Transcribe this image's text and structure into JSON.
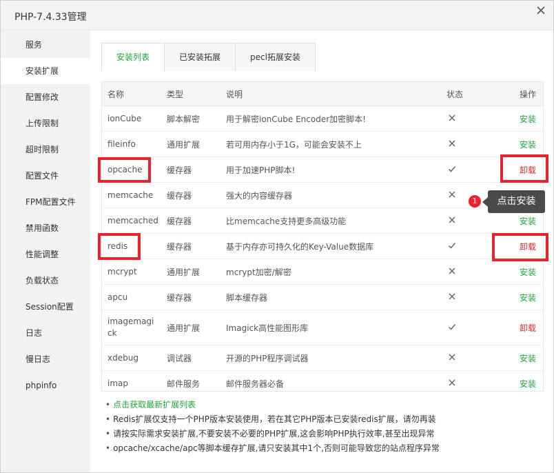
{
  "window": {
    "title": "PHP-7.4.33管理"
  },
  "sidebar": {
    "items": [
      {
        "label": "服务"
      },
      {
        "label": "安装扩展"
      },
      {
        "label": "配置修改"
      },
      {
        "label": "上传限制"
      },
      {
        "label": "超时限制"
      },
      {
        "label": "配置文件"
      },
      {
        "label": "FPM配置文件"
      },
      {
        "label": "禁用函数"
      },
      {
        "label": "性能调整"
      },
      {
        "label": "负载状态"
      },
      {
        "label": "Session配置"
      },
      {
        "label": "日志"
      },
      {
        "label": "慢日志"
      },
      {
        "label": "phpinfo"
      }
    ],
    "active_index": 1
  },
  "tabs": [
    {
      "label": "安装列表"
    },
    {
      "label": "已安装拓展"
    },
    {
      "label": "pecl拓展安装"
    }
  ],
  "table": {
    "headers": {
      "name": "名称",
      "type": "类型",
      "desc": "说明",
      "status": "状态",
      "op": "操作"
    },
    "rows": [
      {
        "name": "ionCube",
        "type": "脚本解密",
        "desc": "用于解密ionCube Encoder加密脚本!",
        "installed": false,
        "op": "安装"
      },
      {
        "name": "fileinfo",
        "type": "通用扩展",
        "desc": "若可用内存小于1G，可能会安装不上",
        "installed": false,
        "op": "安装"
      },
      {
        "name": "opcache",
        "type": "缓存器",
        "desc": "用于加速PHP脚本!",
        "installed": true,
        "op": "卸载"
      },
      {
        "name": "memcache",
        "type": "缓存器",
        "desc": "强大的内容缓存器",
        "installed": false,
        "op": "安装"
      },
      {
        "name": "memcached",
        "type": "缓存器",
        "desc": "比memcache支持更多高级功能",
        "installed": false,
        "op": "安装"
      },
      {
        "name": "redis",
        "type": "缓存器",
        "desc": "基于内存亦可持久化的Key-Value数据库",
        "installed": true,
        "op": "卸载"
      },
      {
        "name": "mcrypt",
        "type": "通用扩展",
        "desc": "mcrypt加密/解密",
        "installed": false,
        "op": "安装"
      },
      {
        "name": "apcu",
        "type": "缓存器",
        "desc": "脚本缓存器",
        "installed": false,
        "op": "安装"
      },
      {
        "name": "imagemagick",
        "type": "通用扩展",
        "desc": "Imagick高性能图形库",
        "installed": true,
        "op": "卸载"
      },
      {
        "name": "xdebug",
        "type": "调试器",
        "desc": "开源的PHP程序调试器",
        "installed": false,
        "op": "安装"
      },
      {
        "name": "imap",
        "type": "邮件服务",
        "desc": "邮件服务器必备",
        "installed": false,
        "op": "安装"
      }
    ]
  },
  "notes": [
    "点击获取最新扩展列表",
    "Redis扩展仅支持一个PHP版本安装使用，若在其它PHP版本已安装redis扩展，请勿再装",
    "请按实际需求安装扩展,不要安装不必要的PHP扩展,这会影响PHP执行效率,甚至出现异常",
    "opcache/xcache/apc等脚本缓存扩展,请只安装其中1个,否则可能导致您的站点程序异常"
  ],
  "annotation": {
    "badge": "1",
    "tooltip": "点击安装"
  },
  "icons": {
    "installed": "check-icon",
    "not_installed": "x-icon",
    "close": "close-icon"
  },
  "colors": {
    "accent_green": "#20a53a",
    "uninstall_red": "#c9302c",
    "highlight_red": "#e8232d"
  }
}
